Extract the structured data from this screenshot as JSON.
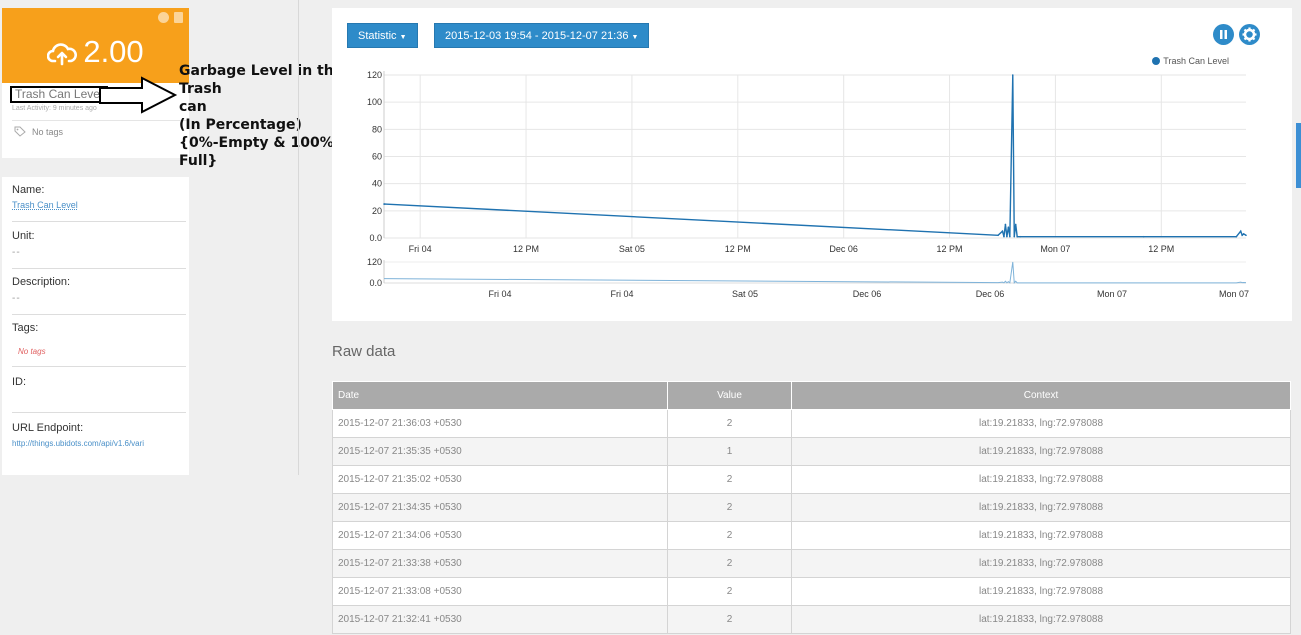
{
  "variable": {
    "value": "2.00",
    "name": "Trash Can Level",
    "last_activity": "Last Activity: 9 minutes ago",
    "tags": "No tags"
  },
  "annotation": {
    "line1": "Garbage Level in the Trash",
    "line2": "can",
    "line3": "(In Percentage)",
    "line4": "{0%-Empty & 100%-Full}"
  },
  "details": {
    "name_label": "Name:",
    "name_value": "Trash Can Level",
    "unit_label": "Unit:",
    "unit_value": "--",
    "description_label": "Description:",
    "description_value": "--",
    "tags_label": "Tags:",
    "tags_value": "No tags",
    "id_label": "ID:",
    "url_label": "URL Endpoint:",
    "url_value": "http://things.ubidots.com/api/v1.6/vari"
  },
  "toolbar": {
    "statistic_label": "Statistic",
    "date_range_label": "2015-12-03 19:54 - 2015-12-07 21:36"
  },
  "chart_data": {
    "type": "line",
    "title": "",
    "xlabel": "",
    "ylabel": "",
    "series": [
      {
        "name": "Trash Can Level",
        "color": "#1f72b0",
        "x": [
          "2015-12-03 19:54",
          "2015-12-03 20:00",
          "2015-12-06 17:30",
          "2015-12-06 18:00",
          "2015-12-06 18:10",
          "2015-12-06 18:20",
          "2015-12-06 18:30",
          "2015-12-06 18:40",
          "2015-12-06 18:50",
          "2015-12-06 19:10",
          "2015-12-06 19:20",
          "2015-12-06 19:30",
          "2015-12-06 19:40",
          "2015-12-06 20:00",
          "2015-12-07 10:00",
          "2015-12-07 20:30",
          "2015-12-07 21:00",
          "2015-12-07 21:10",
          "2015-12-07 21:20",
          "2015-12-07 21:36"
        ],
        "y": [
          25,
          25,
          2,
          5,
          1,
          10,
          1,
          8,
          1,
          120,
          1,
          10,
          1,
          1,
          1,
          1,
          5,
          2,
          3,
          2
        ]
      }
    ],
    "y_ticks": [
      "0.0",
      "20",
      "40",
      "60",
      "80",
      "100",
      "120"
    ],
    "x_ticks": [
      "Fri 04",
      "12 PM",
      "Sat 05",
      "12 PM",
      "Dec 06",
      "12 PM",
      "Mon 07",
      "12 PM"
    ],
    "ylim": [
      0,
      120
    ],
    "navigator": {
      "y_ticks": [
        "0.0",
        "120"
      ],
      "x_ticks": [
        "Fri 04",
        "Fri 04",
        "Sat 05",
        "Dec 06",
        "Dec 06",
        "Mon 07",
        "Mon 07"
      ]
    },
    "legend": "top-right",
    "grid": true
  },
  "raw": {
    "title": "Raw data",
    "headers": [
      "Date",
      "Value",
      "Context"
    ],
    "rows": [
      [
        "2015-12-07 21:36:03 +0530",
        "2",
        "lat:19.21833, lng:72.978088"
      ],
      [
        "2015-12-07 21:35:35 +0530",
        "1",
        "lat:19.21833, lng:72.978088"
      ],
      [
        "2015-12-07 21:35:02 +0530",
        "2",
        "lat:19.21833, lng:72.978088"
      ],
      [
        "2015-12-07 21:34:35 +0530",
        "2",
        "lat:19.21833, lng:72.978088"
      ],
      [
        "2015-12-07 21:34:06 +0530",
        "2",
        "lat:19.21833, lng:72.978088"
      ],
      [
        "2015-12-07 21:33:38 +0530",
        "2",
        "lat:19.21833, lng:72.978088"
      ],
      [
        "2015-12-07 21:33:08 +0530",
        "2",
        "lat:19.21833, lng:72.978088"
      ],
      [
        "2015-12-07 21:32:41 +0530",
        "2",
        "lat:19.21833, lng:72.978088"
      ]
    ]
  }
}
